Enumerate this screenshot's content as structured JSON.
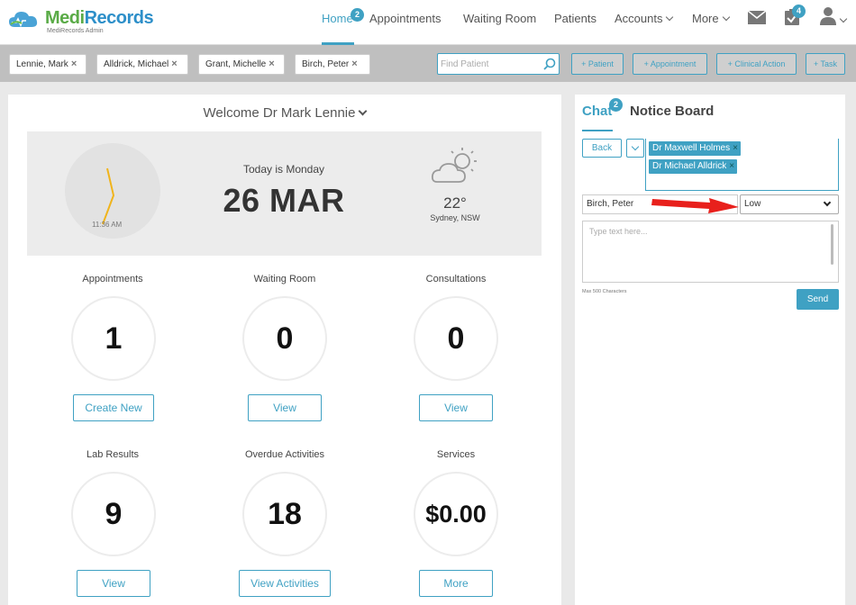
{
  "brand": {
    "name_part1": "Medi",
    "name_part2": "Records",
    "subtitle": "MediRecords Admin"
  },
  "nav": {
    "items": [
      {
        "label": "Home",
        "active": true,
        "badge": "2"
      },
      {
        "label": "Appointments"
      },
      {
        "label": "Waiting Room"
      },
      {
        "label": "Patients"
      },
      {
        "label": "Accounts"
      },
      {
        "label": "More"
      }
    ],
    "mail_icon": "envelope-icon",
    "tasks_icon": "clipboard-check-icon",
    "tasks_badge": "4",
    "user_icon": "user-icon"
  },
  "patient_tabs": [
    "Lennie, Mark",
    "Alldrick, Michael",
    "Grant, Michelle",
    "Birch, Peter"
  ],
  "find_patient": {
    "placeholder": "Find Patient"
  },
  "actions": [
    "+ Patient",
    "+ Appointment",
    "+ Clinical Action",
    "+ Task"
  ],
  "dashboard": {
    "welcome": "Welcome Dr Mark Lennie",
    "clock_time": "11:36 AM",
    "today_label": "Today is Monday",
    "date": "26 MAR",
    "weather": {
      "temp": "22°",
      "location": "Sydney, NSW",
      "icon": "partly-cloudy-icon"
    },
    "tiles": [
      {
        "label": "Appointments",
        "value": "1",
        "button": "Create New"
      },
      {
        "label": "Waiting Room",
        "value": "0",
        "button": "View"
      },
      {
        "label": "Consultations",
        "value": "0",
        "button": "View"
      },
      {
        "label": "Lab Results",
        "value": "9",
        "button": "View"
      },
      {
        "label": "Overdue Activities",
        "value": "18",
        "button": "View Activities"
      },
      {
        "label": "Services",
        "value": "$0.00",
        "button": "More"
      }
    ]
  },
  "chat": {
    "tab_chat": "Chat",
    "chat_badge": "2",
    "tab_notice": "Notice Board",
    "back": "Back",
    "recipients": [
      "Dr Maxwell Holmes",
      "Dr Michael Alldrick"
    ],
    "patient": "Birch, Peter",
    "priority": "Low",
    "message_placeholder": "Type text here...",
    "max_note": "Max 500 Characters",
    "send": "Send"
  },
  "colors": {
    "accent": "#3fa1c3",
    "brand_green": "#5aab47",
    "brand_blue": "#2d8fc9",
    "annotation_arrow": "#e8201c"
  }
}
